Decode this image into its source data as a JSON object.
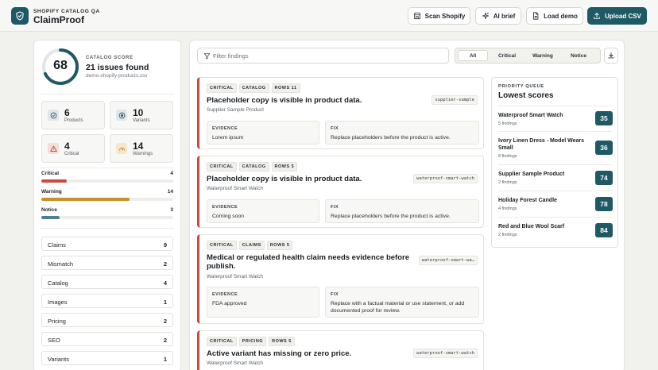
{
  "header": {
    "subtitle": "SHOPIFY CATALOG QA",
    "title": "ClaimProof",
    "buttons": {
      "scan": "Scan Shopify",
      "ai": "AI brief",
      "demo": "Load demo",
      "upload": "Upload CSV"
    }
  },
  "summary": {
    "label": "CATALOG SCORE",
    "score": "68",
    "score_fraction": 0.68,
    "issues": "21 issues found",
    "file": "demo-shopify-products.csv"
  },
  "stats": [
    {
      "value": "6",
      "label": "Products"
    },
    {
      "value": "10",
      "label": "Variants"
    },
    {
      "value": "4",
      "label": "Critical"
    },
    {
      "value": "14",
      "label": "Warnings"
    }
  ],
  "severity": [
    {
      "name": "Critical",
      "count": "4",
      "fraction": 0.19,
      "color": "#c94a43"
    },
    {
      "name": "Warning",
      "count": "14",
      "fraction": 0.67,
      "color": "#c8922a"
    },
    {
      "name": "Notice",
      "count": "3",
      "fraction": 0.14,
      "color": "#4f7d95"
    }
  ],
  "categories": [
    {
      "name": "Claims",
      "count": "9"
    },
    {
      "name": "Mismatch",
      "count": "2"
    },
    {
      "name": "Catalog",
      "count": "4"
    },
    {
      "name": "Images",
      "count": "1"
    },
    {
      "name": "Pricing",
      "count": "2"
    },
    {
      "name": "SEO",
      "count": "2"
    },
    {
      "name": "Variants",
      "count": "1"
    }
  ],
  "toolbar": {
    "filter_placeholder": "Filter findings",
    "tabs": [
      "All",
      "Critical",
      "Warning",
      "Notice"
    ]
  },
  "findings": [
    {
      "chips": [
        "CRITICAL",
        "CATALOG",
        "ROWS 11"
      ],
      "title": "Placeholder copy is visible in product data.",
      "product": "Supplier Sample Product",
      "handle": "supplier-sample",
      "evidence_label": "EVIDENCE",
      "evidence": "Lorem ipsum",
      "fix_label": "FIX",
      "fix": "Replace placeholders before the product is active."
    },
    {
      "chips": [
        "CRITICAL",
        "CATALOG",
        "ROWS 5"
      ],
      "title": "Placeholder copy is visible in product data.",
      "product": "Waterproof Smart Watch",
      "handle": "waterproof-smart-watch",
      "evidence_label": "EVIDENCE",
      "evidence": "Coming soon",
      "fix_label": "FIX",
      "fix": "Replace placeholders before the product is active."
    },
    {
      "chips": [
        "CRITICAL",
        "CLAIMS",
        "ROWS 5"
      ],
      "title": "Medical or regulated health claim needs evidence before publish.",
      "product": "Waterproof Smart Watch",
      "handle": "waterproof-smart-wa…",
      "evidence_label": "EVIDENCE",
      "evidence": "FDA approved",
      "fix_label": "FIX",
      "fix": "Replace with a factual material or use statement, or add documented proof for review."
    },
    {
      "chips": [
        "CRITICAL",
        "PRICING",
        "ROWS 5"
      ],
      "title": "Active variant has missing or zero price.",
      "product": "Waterproof Smart Watch",
      "handle": "waterproof-smart-watch"
    }
  ],
  "queue": {
    "label": "PRIORITY QUEUE",
    "title": "Lowest scores",
    "items": [
      {
        "name": "Waterproof Smart Watch",
        "findings": "5 findings",
        "score": "35"
      },
      {
        "name": "Ivory Linen Dress - Model Wears Small",
        "findings": "8 findings",
        "score": "36"
      },
      {
        "name": "Supplier Sample Product",
        "findings": "2 findings",
        "score": "74"
      },
      {
        "name": "Holiday Forest Candle",
        "findings": "4 findings",
        "score": "78"
      },
      {
        "name": "Red and Blue Wool Scarf",
        "findings": "2 findings",
        "score": "84"
      }
    ]
  }
}
